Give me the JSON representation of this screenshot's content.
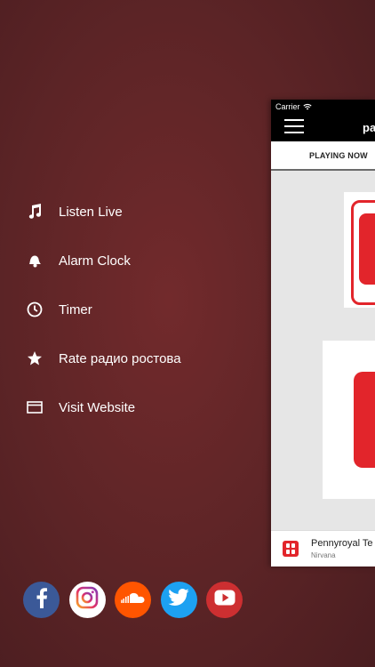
{
  "menu": {
    "items": [
      {
        "label": "Listen Live",
        "icon": "music-note-icon"
      },
      {
        "label": "Alarm Clock",
        "icon": "bell-icon"
      },
      {
        "label": "Timer",
        "icon": "clock-icon"
      },
      {
        "label": "Rate радио ростова",
        "icon": "star-icon"
      },
      {
        "label": "Visit Website",
        "icon": "browser-window-icon"
      }
    ]
  },
  "social": [
    {
      "icon": "facebook-icon",
      "color": "#3b5998"
    },
    {
      "icon": "instagram-icon",
      "color": "#ffffff"
    },
    {
      "icon": "soundcloud-icon",
      "color": "#ff5500"
    },
    {
      "icon": "twitter-icon",
      "color": "#1da1f2"
    },
    {
      "icon": "youtube-icon",
      "color": "#cd2f31"
    }
  ],
  "app": {
    "carrier": "Carrier",
    "title_partial": "pa",
    "tab_label": "PLAYING NOW",
    "now_playing": {
      "track": "Pennyroyal Te",
      "artist": "Nirvana"
    }
  },
  "colors": {
    "background": "#5e2527",
    "accent_red": "#e2252b"
  }
}
